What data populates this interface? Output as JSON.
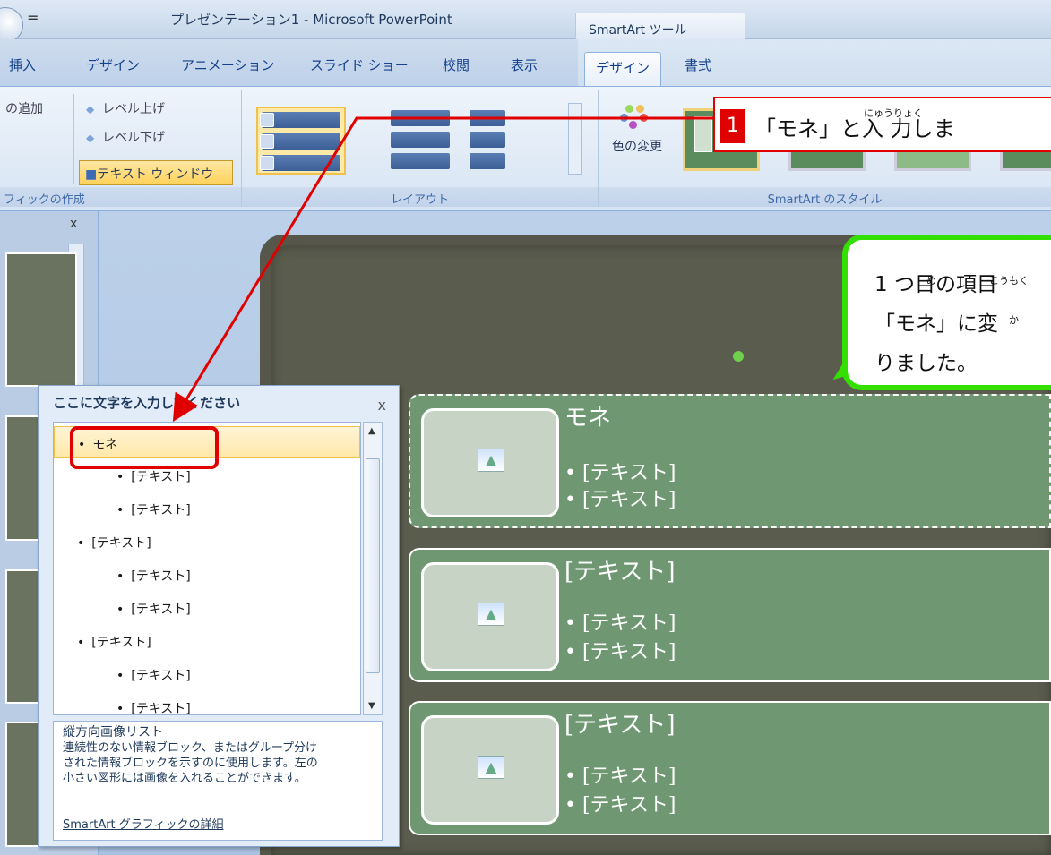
{
  "window": {
    "title": "プレゼンテーション1 - Microsoft PowerPoint",
    "context_tab_header": "SmartArt ツール",
    "qa_arrow": "=",
    "close_glyph": "x"
  },
  "tabs": [
    "挿入",
    "デザイン",
    "アニメーション",
    "スライド ショー",
    "校閲",
    "表示",
    "デザイン",
    "書式"
  ],
  "ribbon": {
    "create_group": {
      "add_label": "の追加",
      "level_up": "レベル上げ",
      "level_down": "レベル下げ",
      "text_window": "テキスト ウィンドウ",
      "group_label": "フィックの作成"
    },
    "layout_group": {
      "group_label": "レイアウト"
    },
    "style_group": {
      "color_change": "色の変更",
      "group_label": "SmartArt のスタイル"
    }
  },
  "text_pane": {
    "title": "ここに文字を入力してください",
    "items": [
      {
        "bullet": "•",
        "text": "モネ",
        "level": 1
      },
      {
        "bullet": "•",
        "text": "[テキスト]",
        "level": 2
      },
      {
        "bullet": "•",
        "text": "[テキスト]",
        "level": 2
      },
      {
        "bullet": "•",
        "text": "[テキスト]",
        "level": 1
      },
      {
        "bullet": "•",
        "text": "[テキスト]",
        "level": 2
      },
      {
        "bullet": "•",
        "text": "[テキスト]",
        "level": 2
      },
      {
        "bullet": "•",
        "text": "[テキスト]",
        "level": 1
      },
      {
        "bullet": "•",
        "text": "[テキスト]",
        "level": 2
      },
      {
        "bullet": "•",
        "text": "[テキスト]",
        "level": 2
      }
    ],
    "desc_title": "縦方向画像リスト",
    "desc_lines": [
      "連続性のない情報ブロック、またはグループ分け",
      "された情報ブロックを示すのに使用します。左の",
      "小さい図形には画像を入れることができます。"
    ],
    "link": "SmartArt グラフィックの詳細"
  },
  "slide_blocks": [
    {
      "title": "モネ",
      "sub1": "• [テキスト]",
      "sub2": "• [テキスト]"
    },
    {
      "title": "[テキスト]",
      "sub1": "• [テキスト]",
      "sub2": "• [テキスト]"
    },
    {
      "title": "[テキスト]",
      "sub1": "• [テキスト]",
      "sub2": "• [テキスト]"
    }
  ],
  "step_callout": {
    "number": "1",
    "text_a": "「モネ」と",
    "text_b": "入",
    "text_c": "力",
    "text_d": "しま",
    "ruby": "にゅうりょく"
  },
  "note_callout": {
    "line1": "1 つ目の項目",
    "line2": "「モネ」に変",
    "line3": "りました。",
    "ruby_me": "め",
    "ruby_koumoku": "こうもく",
    "ruby_ka": "か"
  },
  "colors": {
    "accent_red": "#e00000",
    "accent_green": "#33e000",
    "block_green": "#6f9872"
  }
}
